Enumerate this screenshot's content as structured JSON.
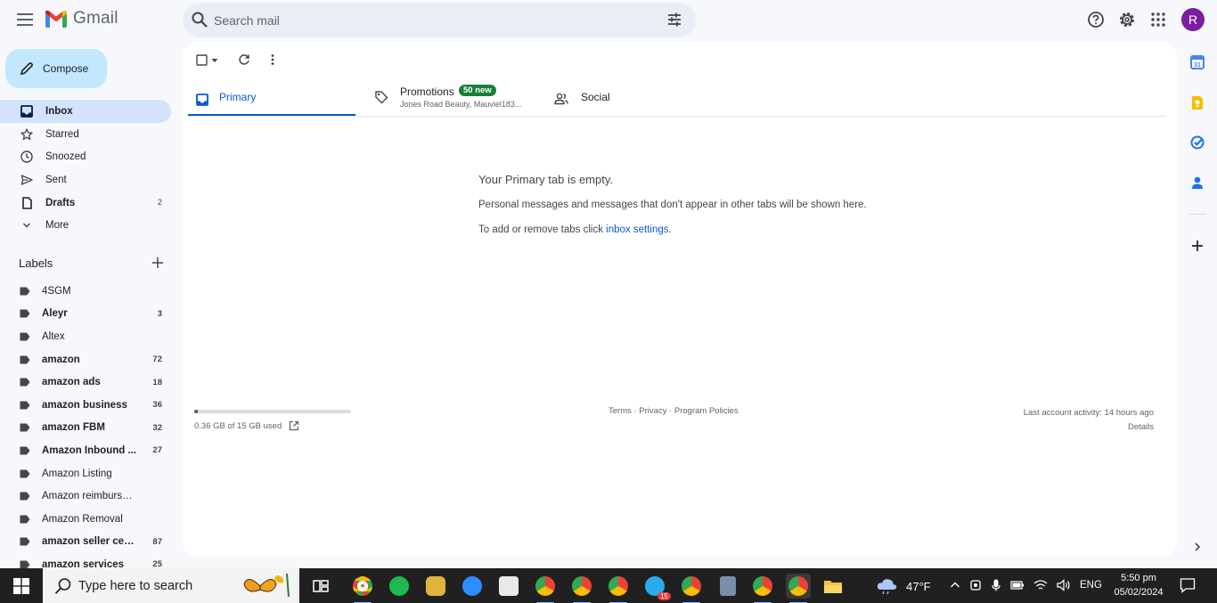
{
  "app": {
    "name": "Gmail"
  },
  "search": {
    "placeholder": "Search mail"
  },
  "account": {
    "avatar_letter": "R"
  },
  "compose": {
    "label": "Compose"
  },
  "nav": [
    {
      "label": "Inbox",
      "icon": "inbox-icon",
      "count": "",
      "active": true,
      "bold": true
    },
    {
      "label": "Starred",
      "icon": "star-icon",
      "count": "",
      "active": false,
      "bold": false
    },
    {
      "label": "Snoozed",
      "icon": "clock-icon",
      "count": "",
      "active": false,
      "bold": false
    },
    {
      "label": "Sent",
      "icon": "send-icon",
      "count": "",
      "active": false,
      "bold": false
    },
    {
      "label": "Drafts",
      "icon": "draft-icon",
      "count": "2",
      "active": false,
      "bold": true
    },
    {
      "label": "More",
      "icon": "chevron-down-icon",
      "count": "",
      "active": false,
      "bold": false
    }
  ],
  "labels": {
    "heading": "Labels",
    "items": [
      {
        "label": "4SGM",
        "count": "",
        "bold": false
      },
      {
        "label": "Aleyr",
        "count": "3",
        "bold": true
      },
      {
        "label": "Altex",
        "count": "",
        "bold": false
      },
      {
        "label": "amazon",
        "count": "72",
        "bold": true
      },
      {
        "label": "amazon ads",
        "count": "18",
        "bold": true
      },
      {
        "label": "amazon business",
        "count": "36",
        "bold": true
      },
      {
        "label": "amazon FBM",
        "count": "32",
        "bold": true
      },
      {
        "label": "Amazon Inbound ...",
        "count": "27",
        "bold": true
      },
      {
        "label": "Amazon Listing",
        "count": "",
        "bold": false
      },
      {
        "label": "Amazon reimbursement",
        "count": "",
        "bold": false
      },
      {
        "label": "Amazon Removal",
        "count": "",
        "bold": false
      },
      {
        "label": "amazon seller cen...",
        "count": "87",
        "bold": true
      },
      {
        "label": "amazon services",
        "count": "25",
        "bold": true
      }
    ]
  },
  "tabs": {
    "primary": "Primary",
    "promotions": "Promotions",
    "promotions_badge": "50 new",
    "promotions_senders": "Jones Road Beauty, Mauviel183...",
    "social": "Social"
  },
  "empty_state": {
    "title": "Your Primary tab is empty.",
    "description": "Personal messages and messages that don't appear in other tabs will be shown here.",
    "settings_prefix": "To add or remove tabs click ",
    "settings_link": "inbox settings",
    "settings_suffix": "."
  },
  "storage": {
    "text": "0.36 GB of 15 GB used",
    "used_fraction": 0.024
  },
  "footer": {
    "links": "Terms · Privacy · Program Policies"
  },
  "activity": {
    "text": "Last account activity: 14 hours ago",
    "details": "Details"
  },
  "taskbar": {
    "search_placeholder": "Type here to search",
    "temperature": "47°F",
    "language": "ENG",
    "time": "5:50 pm",
    "date": "05/02/2024",
    "telegram_badge": "15"
  },
  "colors": {
    "accent": "#0b57d0",
    "compose_bg": "#c2e7ff",
    "active_nav": "#d3e3fd",
    "badge_green": "#188038",
    "avatar": "#7b1fa2"
  }
}
